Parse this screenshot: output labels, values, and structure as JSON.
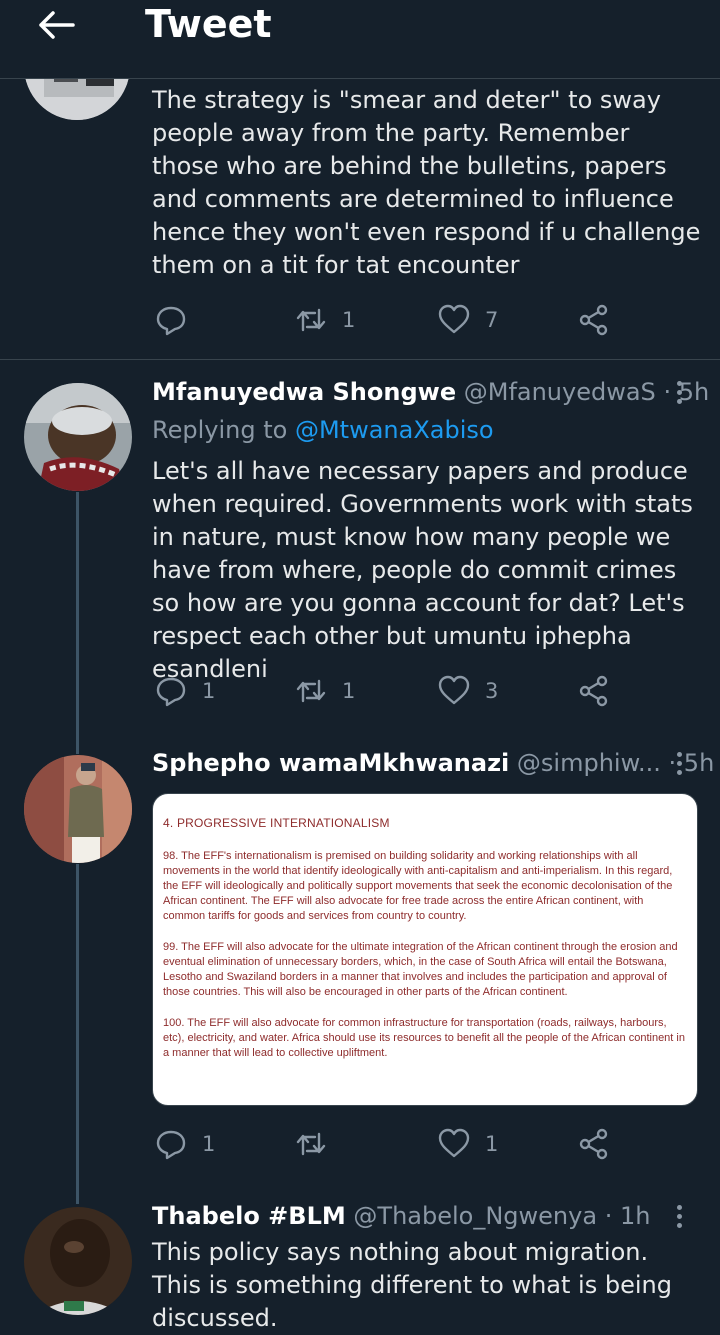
{
  "header": {
    "title": "Tweet"
  },
  "tweets": [
    {
      "text": "The strategy is \"smear and deter\" to sway people away from the party. Remember those who are behind the bulletins, papers and comments are determined to influence hence they won't even respond if u challenge them on a tit for tat encounter",
      "replies": "",
      "retweets": "1",
      "likes": "7"
    },
    {
      "name": "Mfanuyedwa Shongwe",
      "handle": "@MfanuyedwaS",
      "time": "· 5h",
      "replying_label": "Replying to",
      "replying_to": "@MtwanaXabiso",
      "text": "Let's all have necessary papers and produce when required. Governments work with stats in nature, must know how many people we have from where, people do commit crimes so how are you gonna account for dat? Let's respect each other but umuntu iphepha esandleni",
      "replies": "1",
      "retweets": "1",
      "likes": "3"
    },
    {
      "name": "Sphepho wamaMkhwanazi",
      "handle": "@simphiw...",
      "time": "· 5h",
      "image": {
        "heading": "4. PROGRESSIVE INTERNATIONALISM",
        "paragraphs": [
          "98. The EFF's internationalism is premised on building solidarity and working relationships with all movements in the world that identify ideologically with anti-capitalism and anti-imperialism. In this regard, the EFF will ideologically and politically support movements that seek the economic decolonisation of the African continent. The EFF will also advocate for free trade across the entire African continent, with common tariffs for goods and services from country to country.",
          "99. The EFF will also advocate for the ultimate integration of the African continent through the erosion and eventual elimination of unnecessary borders, which, in the case of South Africa will entail the Botswana, Lesotho and Swaziland borders in a manner that involves and includes the participation and approval of those countries. This will also be encouraged in other parts of the African continent.",
          "100. The EFF will also advocate for common infrastructure for transportation (roads, railways, harbours, etc), electricity, and water. Africa should use its resources to benefit all the people of the African continent in a manner that will lead to collective upliftment."
        ]
      },
      "replies": "1",
      "retweets": "",
      "likes": "1"
    },
    {
      "name": "Thabelo #BLM",
      "handle": "@Thabelo_Ngwenya",
      "time": "· 1h",
      "text": "This policy says nothing about migration. This is something different to what is being discussed."
    }
  ],
  "colors": {
    "background": "#15202b",
    "text": "#e7e9ea",
    "muted": "#8b98a5",
    "link": "#1d9bf0",
    "divider": "#38444d"
  },
  "icons": [
    "back-arrow-icon",
    "reply-icon",
    "retweet-icon",
    "like-icon",
    "share-icon",
    "more-icon"
  ]
}
